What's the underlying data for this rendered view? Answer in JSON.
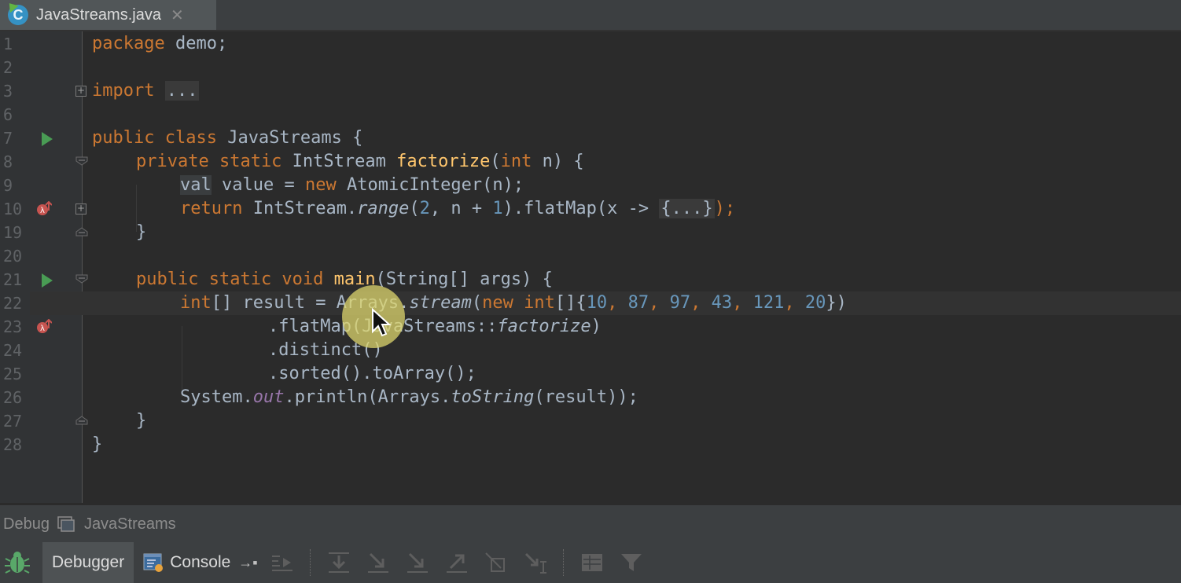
{
  "tab": {
    "file_name": "JavaStreams.java",
    "icon_letter": "C",
    "close_glyph": "✕"
  },
  "code_lines": [
    {
      "number": "1"
    },
    {
      "number": "2"
    },
    {
      "number": "3"
    },
    {
      "number": "6"
    },
    {
      "number": "7"
    },
    {
      "number": "8"
    },
    {
      "number": "9"
    },
    {
      "number": "10"
    },
    {
      "number": "19"
    },
    {
      "number": "20"
    },
    {
      "number": "21"
    },
    {
      "number": "22"
    },
    {
      "number": "23"
    },
    {
      "number": "24"
    },
    {
      "number": "25"
    },
    {
      "number": "26"
    },
    {
      "number": "27"
    },
    {
      "number": "28"
    }
  ],
  "code": {
    "l1_kw": "package",
    "l1_rest": " demo;",
    "l3_kw": "import",
    "l3_folded": "...",
    "l7_kw": "public class",
    "l7_rest": " JavaStreams {",
    "l8_kw1": "private static",
    "l8_type": " IntStream ",
    "l8_fn": "factorize",
    "l8_p1": "(",
    "l8_kw2": "int",
    "l8_p2": " n) {",
    "l9_val": "val",
    "l9_mid": " value = ",
    "l9_kw": "new",
    "l9_rest": " AtomicInteger(n);",
    "l10_kw": "return",
    "l10_a": " IntStream.",
    "l10_range": "range",
    "l10_b": "(",
    "l10_n1": "2",
    "l10_c": ", n + ",
    "l10_n2": "1",
    "l10_d": ").flatMap(x -> ",
    "l10_folded": "{...}",
    "l10_e": ");",
    "l19_text": "}",
    "l21_kw": "public static void",
    "l21_sp": " ",
    "l21_fn": "main",
    "l21_rest": "(String[] args) {",
    "l22_kw": "int",
    "l22_a": "[] result = Arrays.",
    "l22_stream": "stream",
    "l22_b": "(",
    "l22_new": "new",
    "l22_sp": " ",
    "l22_int2": "int",
    "l22_c": "[]{",
    "l22_n1": "10",
    "l22_n2": "87",
    "l22_n3": "97",
    "l22_n4": "43",
    "l22_n5": "121",
    "l22_n6": "20",
    "l22_comma": ", ",
    "l22_d": "})",
    "l23_a": ".flatMap(JavaStreams::",
    "l23_fn": "factorize",
    "l23_b": ")",
    "l24_text": ".distinct()",
    "l25_text": ".sorted().toArray();",
    "l26_a": "System.",
    "l26_out": "out",
    "l26_b": ".println(Arrays.",
    "l26_to": "toString",
    "l26_c": "(result));",
    "l27_text": "}",
    "l28_text": "}"
  },
  "debug_panel": {
    "label": "Debug",
    "session_name": "JavaStreams"
  },
  "toolbar": {
    "debugger_tab": "Debugger",
    "console_tab": "Console",
    "console_pin": "→▪"
  },
  "colors": {
    "keyword": "#cc7832",
    "function": "#ffc66d",
    "number": "#6897bb",
    "static_field": "#9876aa",
    "text": "#a9b7c6",
    "background": "#2b2b2b"
  },
  "icons": [
    "run-icon",
    "lambda-breakpoint-icon",
    "fold-icon",
    "bug-icon",
    "console-icon",
    "step-over-icon",
    "step-into-icon",
    "force-step-into-icon",
    "step-out-icon",
    "drop-frame-icon",
    "run-to-cursor-icon",
    "evaluate-icon",
    "filter-icon"
  ]
}
